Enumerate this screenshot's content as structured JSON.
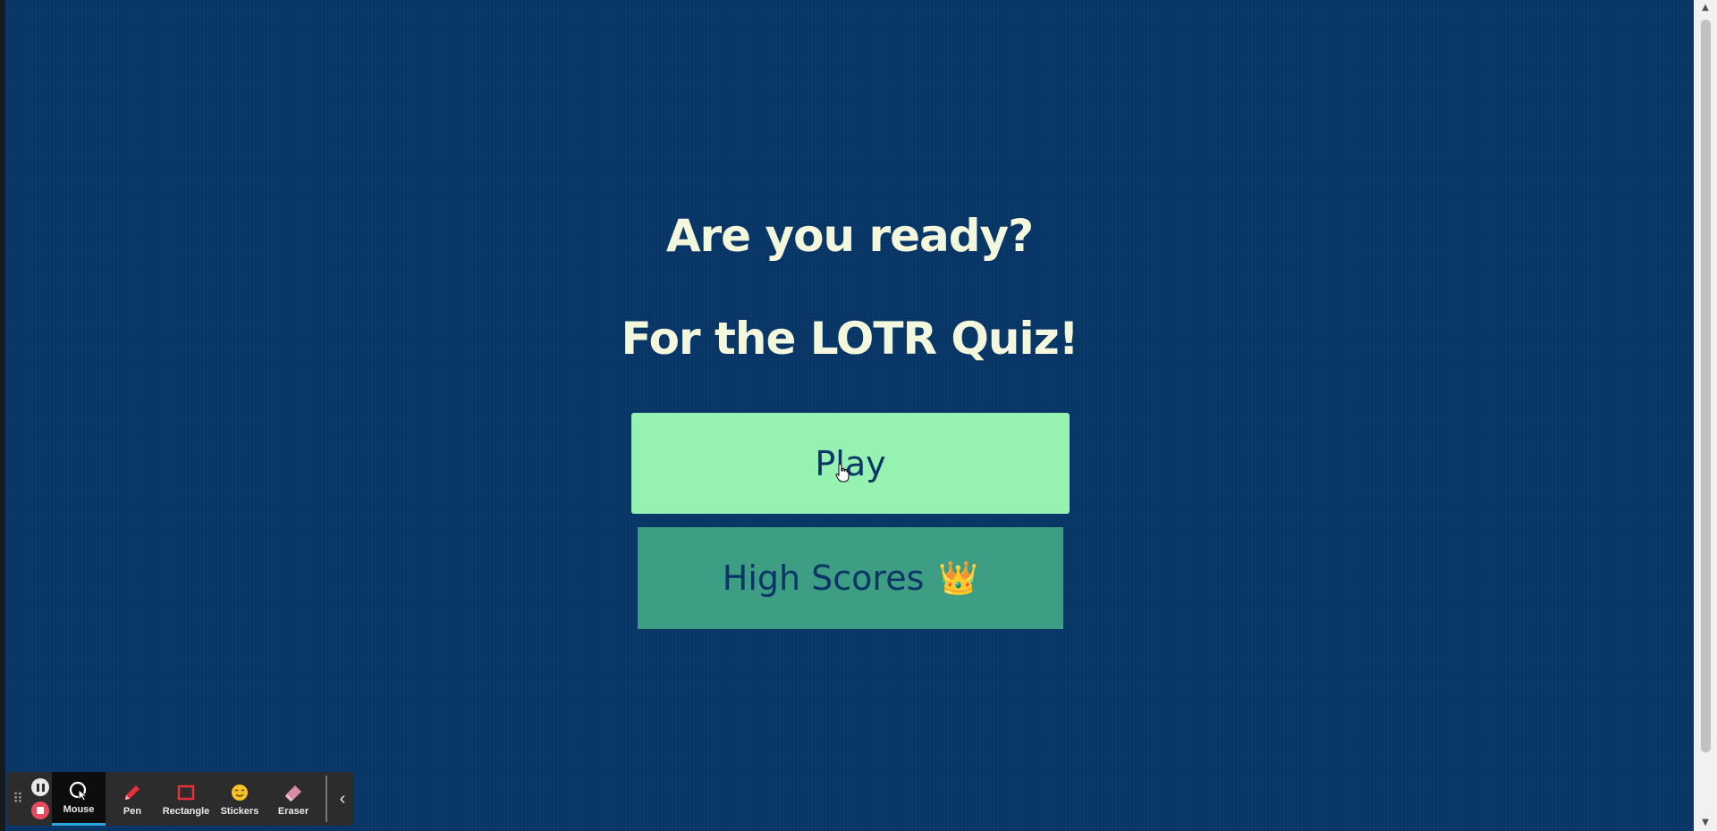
{
  "quiz": {
    "heading": "Are you ready?",
    "subheading": "For the LOTR Quiz!",
    "play_label": "Play",
    "high_scores_label": "High Scores",
    "high_scores_icon": "👑"
  },
  "toolbar": {
    "tools": [
      {
        "label": "Mouse",
        "icon": "mouse-cursor-icon"
      },
      {
        "label": "Pen",
        "icon": "pen-icon"
      },
      {
        "label": "Rectangle",
        "icon": "rectangle-icon"
      },
      {
        "label": "Stickers",
        "icon": "sticker-icon"
      },
      {
        "label": "Eraser",
        "icon": "eraser-icon"
      }
    ],
    "active_tool": "Mouse"
  },
  "colors": {
    "background": "#063566",
    "heading_text": "#f3f7dc",
    "play_button": "#95f2b0",
    "high_scores_button": "#3d9e84",
    "button_text": "#0b3566"
  }
}
